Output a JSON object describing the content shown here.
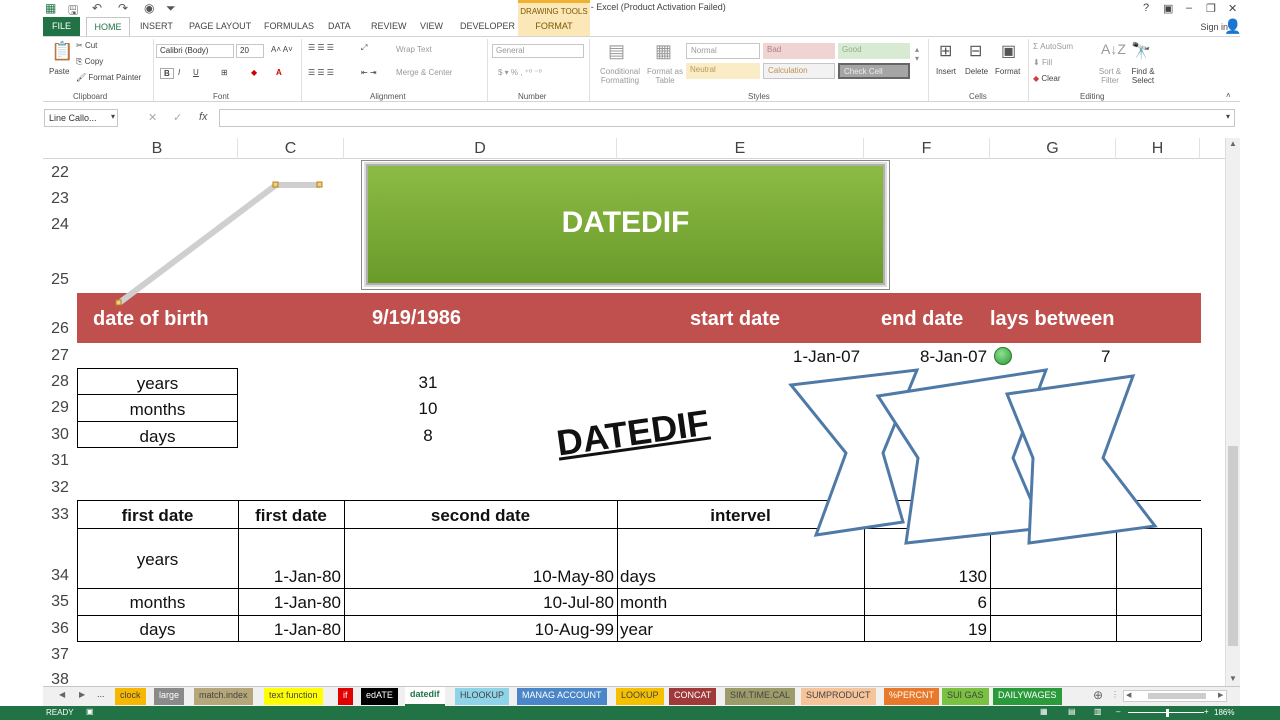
{
  "window": {
    "title": "advance - Excel (Product Activation Failed)",
    "contextual_tab_group": "DRAWING TOOLS",
    "help": "?",
    "sign_in": "Sign in"
  },
  "ribbon_tabs": [
    "FILE",
    "HOME",
    "INSERT",
    "PAGE LAYOUT",
    "FORMULAS",
    "DATA",
    "REVIEW",
    "VIEW",
    "DEVELOPER",
    "FORMAT"
  ],
  "ribbon": {
    "clipboard": {
      "paste": "Paste",
      "cut": "Cut",
      "copy": "Copy",
      "format_painter": "Format Painter",
      "label": "Clipboard"
    },
    "font": {
      "name": "Calibri (Body)",
      "size": "20",
      "label": "Font"
    },
    "alignment": {
      "wrap": "Wrap Text",
      "merge": "Merge & Center",
      "label": "Alignment"
    },
    "number": {
      "format": "General",
      "label": "Number"
    },
    "styles": {
      "conditional": "Conditional Formatting",
      "format_table": "Format as Table",
      "cells": [
        "Normal",
        "Bad",
        "Good",
        "Neutral",
        "Calculation",
        "Check Cell"
      ],
      "label": "Styles"
    },
    "cells": {
      "insert": "Insert",
      "delete": "Delete",
      "format": "Format",
      "label": "Cells"
    },
    "editing": {
      "autosum": "AutoSum",
      "fill": "Fill",
      "clear": "Clear",
      "sort": "Sort & Filter",
      "find": "Find & Select",
      "label": "Editing"
    }
  },
  "formula_bar": {
    "name_box": "Line Callo...",
    "fx": "fx",
    "content": ""
  },
  "columns": [
    "B",
    "C",
    "D",
    "E",
    "F",
    "G",
    "H"
  ],
  "rows": [
    "22",
    "23",
    "24",
    "25",
    "26",
    "27",
    "28",
    "29",
    "30",
    "31",
    "32",
    "33",
    "34",
    "35",
    "36",
    "37",
    "38"
  ],
  "shapes": {
    "banner_text": "DATEDIF",
    "wordart_text": "DATEDIF"
  },
  "header_row": {
    "dob_label": "date of birth",
    "dob_value": "9/19/1986",
    "start_date": "start date",
    "end_date": "end date",
    "days_between": "lays between"
  },
  "row27": {
    "start": "1-Jan-07",
    "end": "8-Jan-07",
    "days": "7"
  },
  "age_table": [
    {
      "label": "years",
      "value": "31"
    },
    {
      "label": "months",
      "value": "10"
    },
    {
      "label": "days",
      "value": "8"
    }
  ],
  "interval_table": {
    "headers": [
      "first date",
      "first date",
      "second date",
      "intervel"
    ],
    "rows": [
      {
        "label": "years",
        "first": "1-Jan-80",
        "second": "10-May-80",
        "interval": "days",
        "result": "130"
      },
      {
        "label": "months",
        "first": "1-Jan-80",
        "second": "10-Jul-80",
        "interval": "month",
        "result": "6"
      },
      {
        "label": "days",
        "first": "1-Jan-80",
        "second": "10-Aug-99",
        "interval": "year",
        "result": "19"
      }
    ]
  },
  "sheet_tabs": [
    {
      "name": "clock",
      "color": "#f5b700"
    },
    {
      "name": "large",
      "color": "#8a8a8a"
    },
    {
      "name": "match.index",
      "color": "#b5a77a"
    },
    {
      "name": "text function",
      "color": "#ffff00"
    },
    {
      "name": "if",
      "color": "#e00000"
    },
    {
      "name": "edATE",
      "color": "#000000"
    },
    {
      "name": "datedif",
      "color": "#ffffff"
    },
    {
      "name": "HLOOKUP",
      "color": "#8fd3e8"
    },
    {
      "name": "MANAG ACCOUNT",
      "color": "#4a86c8"
    },
    {
      "name": "LOOKUP",
      "color": "#f5c000"
    },
    {
      "name": "CONCAT",
      "color": "#a03a3a"
    },
    {
      "name": "SIM.TIME.CAL",
      "color": "#9c9c6a"
    },
    {
      "name": "SUMPRODUCT",
      "color": "#f6c49a"
    },
    {
      "name": "%PERCNT",
      "color": "#e8782a"
    },
    {
      "name": "SUI GAS",
      "color": "#7ac142"
    },
    {
      "name": "DAILYWAGES",
      "color": "#2a9a3a"
    }
  ],
  "sheet_nav_ellipsis": "...",
  "status": {
    "ready": "READY",
    "zoom": "186%"
  },
  "colors": {
    "excel_green": "#217346",
    "header_band": "#c0504d",
    "banner_green": "#76a32f",
    "flag_stroke": "#4f7aa8"
  }
}
